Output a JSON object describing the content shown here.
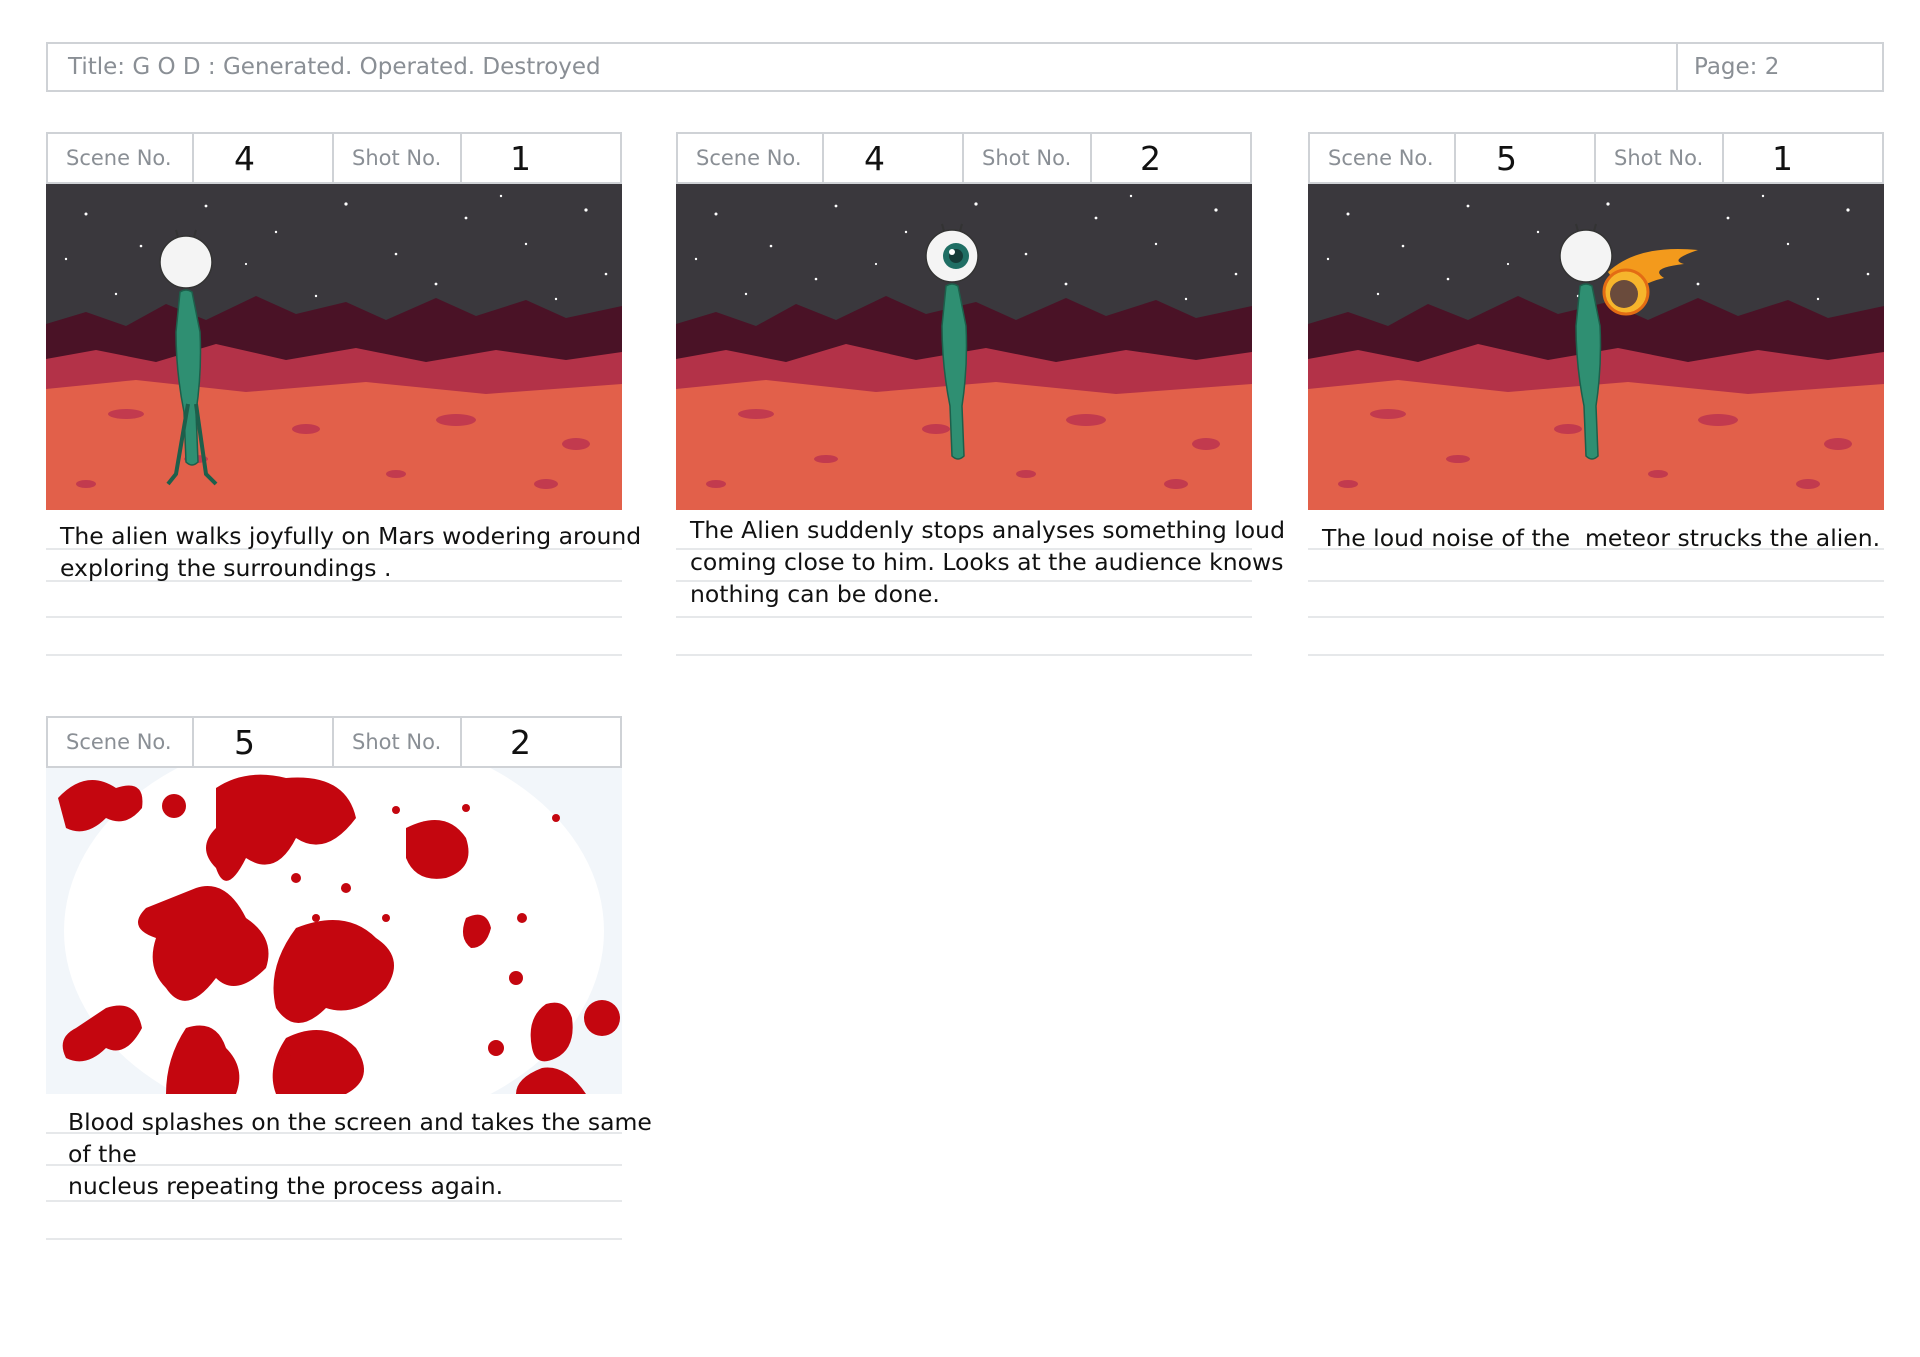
{
  "header": {
    "title": "Title: G O D : Generated. Operated. Destroyed",
    "page": "Page: 2"
  },
  "labels": {
    "scene": "Scene No.",
    "shot": "Shot No."
  },
  "panels": [
    {
      "scene": "4",
      "shot": "1",
      "description": "The alien walks joyfully on Mars wodering around\nexploring the surroundings ."
    },
    {
      "scene": "4",
      "shot": "2",
      "description": "The Alien suddenly stops analyses something loud\ncoming close to him. Looks at the audience knows\nnothing can be done."
    },
    {
      "scene": "5",
      "shot": "1",
      "description": "The loud noise of the  meteor strucks the alien."
    },
    {
      "scene": "5",
      "shot": "2",
      "description": "Blood splashes on the screen and takes the same of the\nnucleus repeating the process again."
    }
  ],
  "colors": {
    "sky": "#3a383d",
    "mountain": "#4a1226",
    "ground": "#e2604a",
    "alien": "#2f8f72",
    "blood": "#c4060f"
  }
}
